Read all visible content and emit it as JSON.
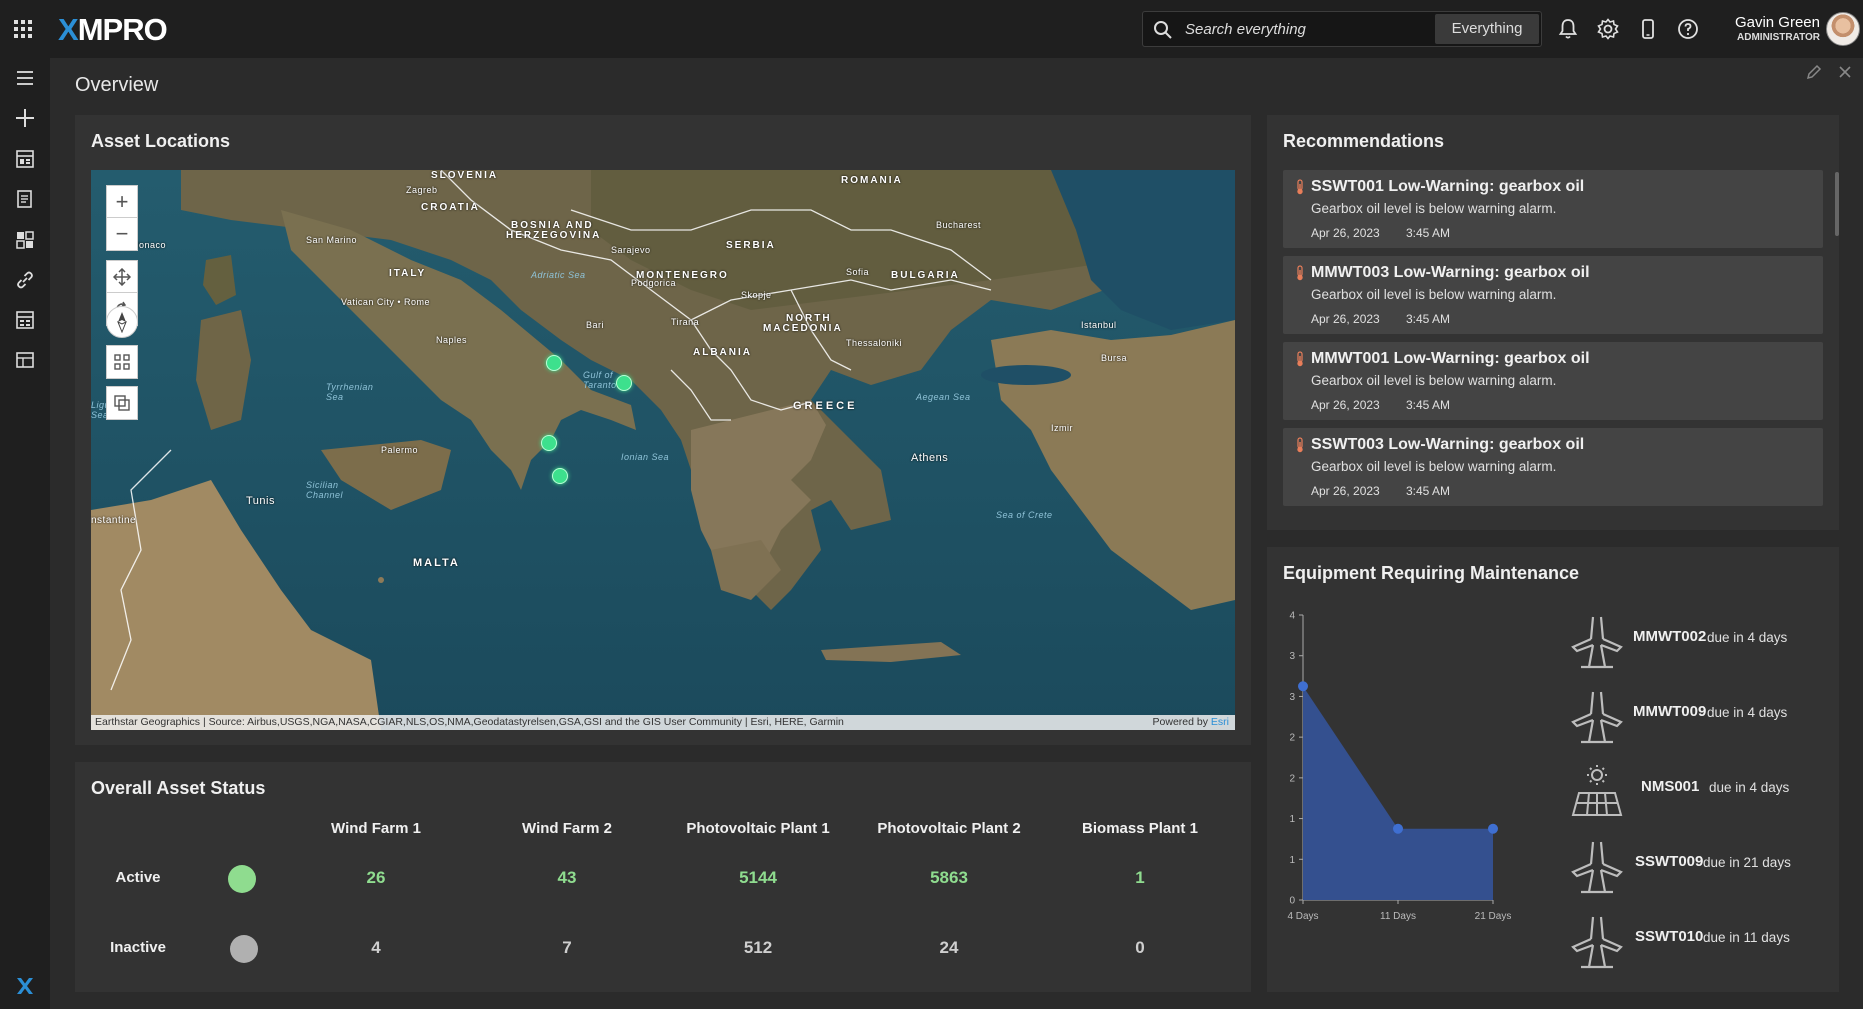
{
  "app": {
    "logo_text": "MPRO",
    "logo_x": "X"
  },
  "search": {
    "placeholder": "Search everything",
    "scope": "Everything"
  },
  "user": {
    "name": "Gavin Green",
    "role": "ADMINISTRATOR"
  },
  "page": {
    "title": "Overview"
  },
  "asset_locations": {
    "title": "Asset Locations",
    "attribution": "Earthstar Geographics | Source: Airbus,USGS,NGA,NASA,CGIAR,NLS,OS,NMA,Geodatastyrelsen,GSA,GSI and the GIS User Community | Esri, HERE, Garmin",
    "powered_by": "Powered by",
    "esri": "Esri",
    "labels": {
      "slovenia": "SLOVENIA",
      "croatia": "CROATIA",
      "bosnia": "BOSNIA AND",
      "herzegovina": "HERZEGOVINA",
      "romania": "ROMANIA",
      "serbia": "SERBIA",
      "bulgaria": "BULGARIA",
      "montenegro": "MONTENEGRO",
      "italy": "ITALY",
      "north": "NORTH",
      "macedonia": "MACEDONIA",
      "albania": "ALBANIA",
      "greece": "GREECE",
      "malta": "MALTA",
      "sarajevo": "Sarajevo",
      "vatican": "Vatican City • Rome",
      "naples": "Naples",
      "bari": "Bari",
      "tirana": "Tirana",
      "sofia": "Sofia",
      "thessaloniki": "Thessaloniki",
      "istanbul": "Istanbul",
      "bursa": "Bursa",
      "izmir": "Izmir",
      "athens": "Athens",
      "palermo": "Palermo",
      "tunis": "Tunis",
      "podgorica": "Podgorica",
      "skopje": "Skopje",
      "bucharest": "Bucharest",
      "zagreb": "Zagreb",
      "san_marino": "San Marino",
      "adriatic": "Adriatic Sea",
      "tyrrhenian": "Tyrrhenian Sea",
      "ionian": "Ionian Sea",
      "aegean": "Aegean Sea",
      "crete": "Sea of Crete",
      "sicilian": "Sicilian Channel",
      "taranto": "Gulf of Taranto",
      "ligurian": "Ligurian Sea",
      "constantine": "nstantine",
      "monaco": "Monaco"
    }
  },
  "overall_status": {
    "title": "Overall Asset Status",
    "columns": [
      "Wind Farm 1",
      "Wind Farm 2",
      "Photovoltaic Plant 1",
      "Photovoltaic Plant 2",
      "Biomass Plant 1"
    ],
    "rows": [
      {
        "label": "Active",
        "color": "#8fdc8f",
        "values": [
          "26",
          "43",
          "5144",
          "5863",
          "1"
        ]
      },
      {
        "label": "Inactive",
        "color": "#b0b0b0",
        "values": [
          "4",
          "7",
          "512",
          "24",
          "0"
        ]
      }
    ]
  },
  "recommendations": {
    "title": "Recommendations",
    "items": [
      {
        "title": "SSWT001 Low-Warning: gearbox oil",
        "desc": "Gearbox oil level is below warning alarm.",
        "date": "Apr 26, 2023",
        "time": "3:45 AM"
      },
      {
        "title": "MMWT003 Low-Warning: gearbox oil",
        "desc": "Gearbox oil level is below warning alarm.",
        "date": "Apr 26, 2023",
        "time": "3:45 AM"
      },
      {
        "title": "MMWT001 Low-Warning: gearbox oil",
        "desc": "Gearbox oil level is below warning alarm.",
        "date": "Apr 26, 2023",
        "time": "3:45 AM"
      },
      {
        "title": "SSWT003 Low-Warning: gearbox oil",
        "desc": "Gearbox oil level is below warning alarm.",
        "date": "Apr 26, 2023",
        "time": "3:45 AM"
      }
    ]
  },
  "maintenance": {
    "title": "Equipment Requiring Maintenance",
    "items": [
      {
        "name": "MMWT002",
        "due": "due in 4 days",
        "icon": "wind-turbine-icon"
      },
      {
        "name": "MMWT009",
        "due": "due in 4 days",
        "icon": "wind-turbine-icon"
      },
      {
        "name": "NMS001",
        "due": "due in 4 days",
        "icon": "solar-panel-icon"
      },
      {
        "name": "SSWT009",
        "due": "due in 21 days",
        "icon": "wind-turbine-icon"
      },
      {
        "name": "SSWT010",
        "due": "due in 11 days",
        "icon": "wind-turbine-icon"
      }
    ]
  },
  "chart_data": {
    "type": "area",
    "categories": [
      "4 Days",
      "11 Days",
      "21 Days"
    ],
    "values": [
      3,
      1,
      1
    ],
    "y_tick_labels": [
      "0",
      "1",
      "1",
      "2",
      "2",
      "3",
      "3",
      "4"
    ],
    "ylim": [
      0,
      4
    ],
    "color": "#34508f",
    "point_color": "#3f6fd1"
  }
}
